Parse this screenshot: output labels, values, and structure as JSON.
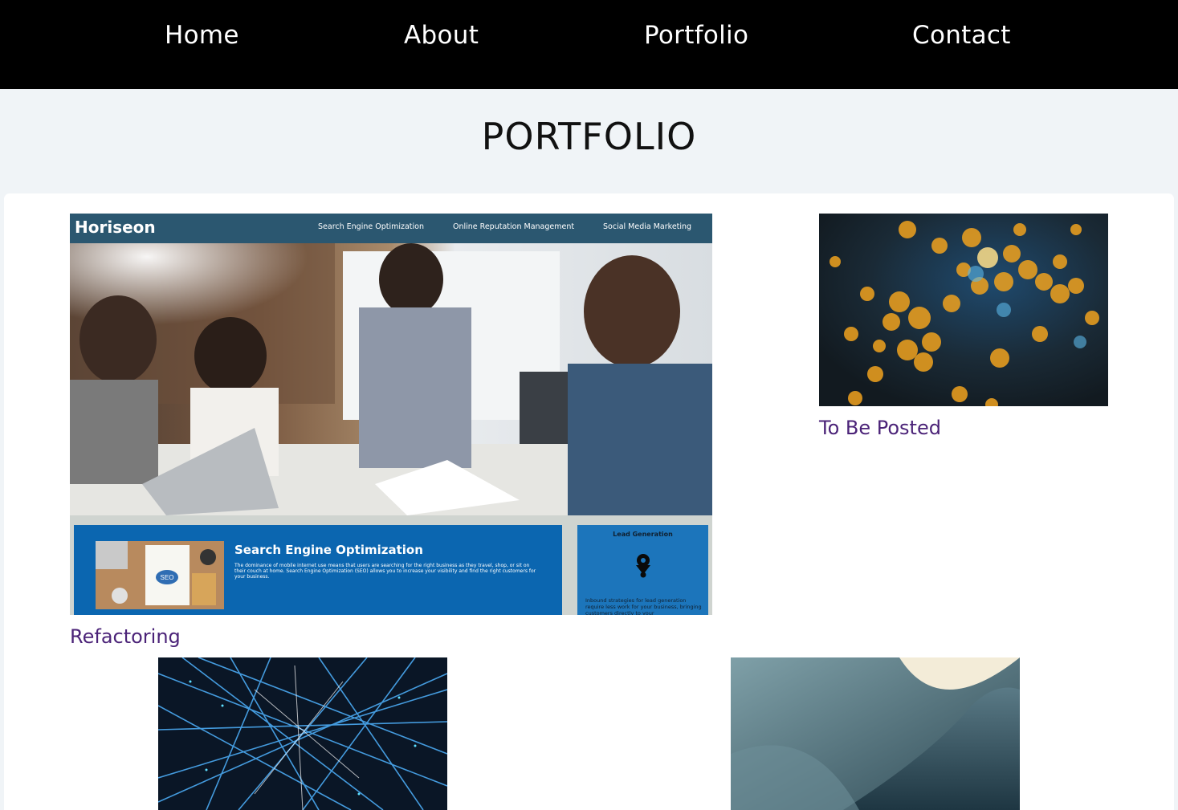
{
  "nav": {
    "items": [
      {
        "label": "Home"
      },
      {
        "label": "About"
      },
      {
        "label": "Portfolio"
      },
      {
        "label": "Contact"
      }
    ]
  },
  "page_title": "PORTFOLIO",
  "projects": [
    {
      "caption": "Refactoring",
      "screenshot": {
        "logo": "Horiseon",
        "nav": [
          "Search Engine Optimization",
          "Online Reputation Management",
          "Social Media Marketing"
        ],
        "section_title": "Search Engine Optimization",
        "section_text": "The dominance of mobile internet use means that users are searching for the right business as they travel, shop, or sit on their couch at home. Search Engine Optimization (SEO) allows you to increase your visibility and find the right customers for your business.",
        "seo_badge": "SEO",
        "side_title": "Lead Generation",
        "side_text": "Inbound strategies for lead generation require less work for your business, bringing customers directly to your"
      }
    },
    {
      "caption": "To Be Posted"
    },
    {
      "caption": ""
    },
    {
      "caption": ""
    }
  ]
}
